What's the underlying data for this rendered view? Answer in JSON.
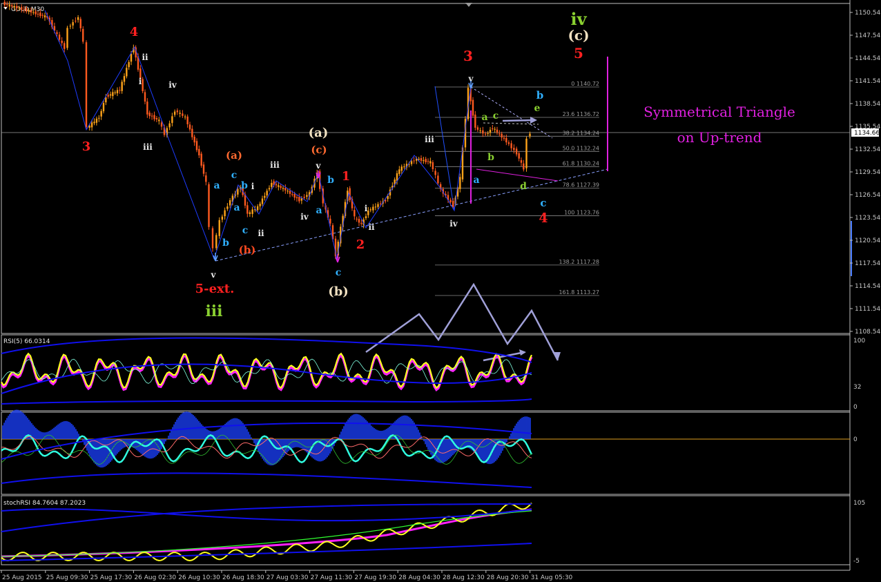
{
  "window": {
    "title": "GOLD,M30",
    "current_price": "1134.66"
  },
  "colors": {
    "background": "#000000",
    "frame": "#c0c0c0",
    "bull_candle": "#ffa31a",
    "bear_candle": "#ff5a1f",
    "trendline": "#1e3cff",
    "arrow": "#a0a0d8",
    "annotation": "#e020e0",
    "rsi_main": "#ffff20",
    "rsi_shadow": "#ff20ff",
    "band": "#1010ee",
    "histogram": "#1a40ff",
    "cyan_line": "#30ffe0"
  },
  "price_axis": {
    "ticks": [
      "1150.54",
      "1147.54",
      "1144.54",
      "1141.54",
      "1138.54",
      "1135.54",
      "1132.54",
      "1129.54",
      "1126.54",
      "1123.54",
      "1120.54",
      "1117.54",
      "1114.54",
      "1111.54",
      "1108.54"
    ]
  },
  "time_axis": {
    "ticks": [
      "25 Aug 2015",
      "25 Aug 09:30",
      "25 Aug 17:30",
      "26 Aug 02:30",
      "26 Aug 10:30",
      "26 Aug 18:30",
      "27 Aug 03:30",
      "27 Aug 11:30",
      "27 Aug 19:30",
      "28 Aug 04:30",
      "28 Aug 12:30",
      "28 Aug 20:30",
      "31 Aug 05:30"
    ]
  },
  "fibonacci": {
    "levels": [
      {
        "label": "0 1140.72",
        "price": 1140.72
      },
      {
        "label": "23.6 1136.72",
        "price": 1136.72
      },
      {
        "label": "38.2 1134.24",
        "price": 1134.24
      },
      {
        "label": "50.0 1132.24",
        "price": 1132.24
      },
      {
        "label": "61.8 1130.24",
        "price": 1130.24
      },
      {
        "label": "78.6 1127.39",
        "price": 1127.39
      },
      {
        "label": "100 1123.76",
        "price": 1123.76
      },
      {
        "label": "138.2 1117.28",
        "price": 1117.28
      },
      {
        "label": "161.8 1113.27",
        "price": 1113.27
      }
    ]
  },
  "annotation": {
    "line1": "Symmetrical Triangle",
    "line2": "on Up-trend"
  },
  "wave_labels": {
    "red_3_left": "3",
    "red_4": "4",
    "ii_1": "ii",
    "i_1": "i",
    "iv_1": "iv",
    "iii_1": "iii",
    "a_1": "a",
    "c_1": "c",
    "b_1": "b",
    "i_2": "i",
    "a_2": "a",
    "b_2": "b",
    "c_2": "c",
    "ii_2": "ii",
    "iii_2": "iii",
    "iv_2": "iv",
    "v_1": "v",
    "paren_a": "(a)",
    "paren_c": "(c)",
    "v_2": "v",
    "b_3": "b",
    "a_3": "a",
    "paren_b_small": "(b)",
    "ext": "5-ext.",
    "iii_green": "iii",
    "paren_a_white": "(a)",
    "red_1": "1",
    "red_2": "2",
    "c_3": "c",
    "paren_b_big": "(b)",
    "i_3": "i",
    "ii_3": "ii",
    "iii_3": "iii",
    "iv_3": "iv",
    "red_3_top": "3",
    "v_3": "v",
    "a_4": "a",
    "c_4": "c",
    "b_4": "b",
    "a_5": "a",
    "d_1": "d",
    "b_5": "b",
    "e_1": "e",
    "c_5": "c",
    "red_4_right": "4",
    "iv_green": "iv",
    "paren_c_white": "(c)",
    "red_5": "5"
  },
  "indicators": {
    "rsi": {
      "label": "RSI(5) 66.0314",
      "axis": [
        "100",
        "32",
        "0"
      ]
    },
    "osc": {
      "axis": [
        "0"
      ]
    },
    "stoch": {
      "label": "stochRSI 84.7604 87.2023",
      "axis": [
        "105",
        "-5"
      ]
    }
  }
}
